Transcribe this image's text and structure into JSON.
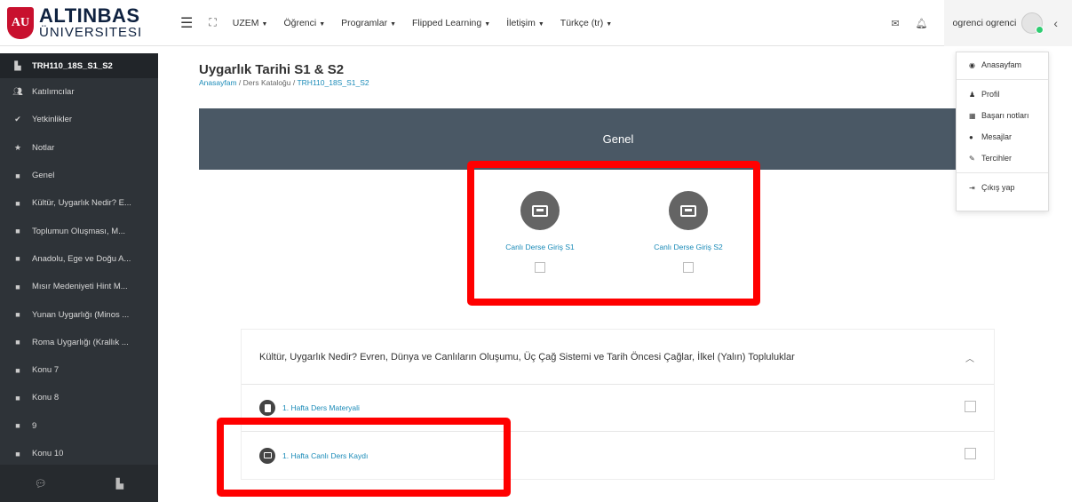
{
  "brand": {
    "logo_mark": "AU",
    "line1": "ALTINBAS",
    "line2": "ÜNIVERSITESI"
  },
  "navbar": {
    "items": [
      {
        "label": "UZEM"
      },
      {
        "label": "Öğrenci"
      },
      {
        "label": "Programlar"
      },
      {
        "label": "Flipped Learning"
      },
      {
        "label": "İletişim"
      },
      {
        "label": "Türkçe (tr)"
      }
    ],
    "user_name": "ogrenci ogrenci"
  },
  "sidebar": {
    "items": [
      {
        "label": "TRH110_18S_S1_S2",
        "icon": "course-icon"
      },
      {
        "label": "Katılımcılar",
        "icon": "users-icon"
      },
      {
        "label": "Yetkinlikler",
        "icon": "check-circle-icon"
      },
      {
        "label": "Notlar",
        "icon": "star-icon"
      },
      {
        "label": "Genel",
        "icon": "folder-icon"
      },
      {
        "label": "Kültür, Uygarlık Nedir? E...",
        "icon": "folder-icon"
      },
      {
        "label": "Toplumun Oluşması, M...",
        "icon": "folder-icon"
      },
      {
        "label": "Anadolu, Ege ve Doğu A...",
        "icon": "folder-icon"
      },
      {
        "label": "Mısır Medeniyeti Hint M...",
        "icon": "folder-icon"
      },
      {
        "label": "Yunan Uygarlığı (Minos ...",
        "icon": "folder-icon"
      },
      {
        "label": "Roma Uygarlığı (Krallık ...",
        "icon": "folder-icon"
      },
      {
        "label": "Konu 7",
        "icon": "folder-icon"
      },
      {
        "label": "Konu 8",
        "icon": "folder-icon"
      },
      {
        "label": "9",
        "icon": "folder-icon"
      },
      {
        "label": "Konu 10",
        "icon": "folder-icon"
      }
    ]
  },
  "page": {
    "title": "Uygarlık Tarihi S1 & S2",
    "breadcrumb": [
      "Anasayfam",
      "Ders Kataloğu",
      "TRH110_18S_S1_S2"
    ],
    "genel": "Genel",
    "live": [
      {
        "label": "Canlı Derse Giriş S1"
      },
      {
        "label": "Canlı Derse Giriş S2"
      }
    ],
    "section": {
      "title": "Kültür, Uygarlık Nedir? Evren, Dünya ve Canlıların Oluşumu, Üç Çağ Sistemi ve Tarih Öncesi Çağlar, İlkel (Yalın) Topluluklar",
      "activities": [
        {
          "label": "1. Hafta Ders Materyali"
        },
        {
          "label": "1. Hafta Canlı Ders Kaydı"
        }
      ]
    }
  },
  "dropdown": {
    "items": [
      {
        "label": "Anasayfam"
      },
      {
        "label": "Profil"
      },
      {
        "label": "Başarı notları"
      },
      {
        "label": "Mesajlar"
      },
      {
        "label": "Tercihler"
      },
      {
        "label": "Çıkış yap"
      }
    ]
  },
  "colors": {
    "highlight": "#ff0000",
    "link": "#1b8bb8",
    "banner": "#4a5865",
    "sidebar": "#2e3338"
  }
}
